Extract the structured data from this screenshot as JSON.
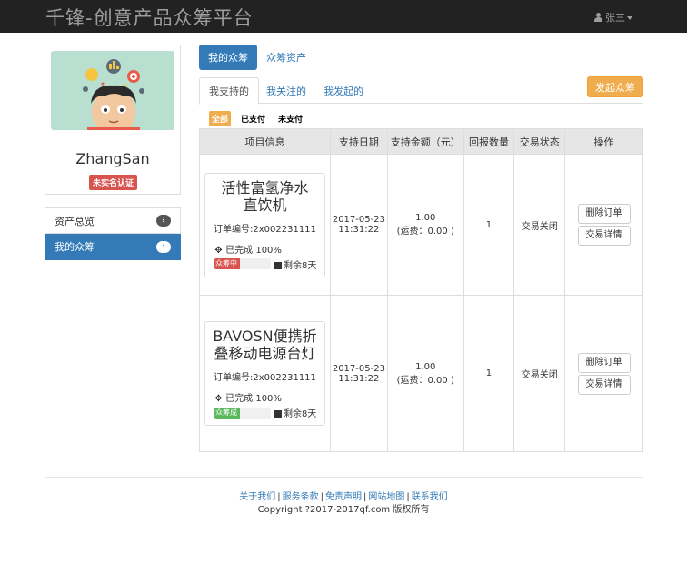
{
  "navbar": {
    "brand": "千锋-创意产品众筹平台",
    "user": "张三"
  },
  "profile": {
    "username": "ZhangSan",
    "badge": "未实名认证"
  },
  "side_menu": [
    {
      "label": "资产总览",
      "active": false
    },
    {
      "label": "我的众筹",
      "active": true
    }
  ],
  "pill_tabs": [
    {
      "label": "我的众筹",
      "active": true
    },
    {
      "label": "众筹资产",
      "active": false
    }
  ],
  "sub_tabs": [
    {
      "label": "我支持的",
      "active": true
    },
    {
      "label": "我关注的",
      "active": false
    },
    {
      "label": "我发起的",
      "active": false
    }
  ],
  "launch_button": "发起众筹",
  "filters": [
    {
      "label": "全部",
      "active": true
    },
    {
      "label": "已支付",
      "active": false
    },
    {
      "label": "未支付",
      "active": false
    }
  ],
  "table": {
    "headers": [
      "项目信息",
      "支持日期",
      "支持金额（元）",
      "回报数量",
      "交易状态",
      "操作"
    ],
    "rows": [
      {
        "title": "活性富氢净水直饮机",
        "order_no": "订单编号:2x002231111",
        "done": "已完成 100%",
        "status_label": "众筹中",
        "status_color": "#d9534f",
        "progress": 100,
        "remain": "剩余8天",
        "date": "2017-05-23",
        "time": "11:31:22",
        "amount": "1.00",
        "shipping": "(运费：0.00 )",
        "qty": "1",
        "trade_status": "交易关闭",
        "btn_delete": "删除订单",
        "btn_detail": "交易详情"
      },
      {
        "title": "BAVOSN便携折叠移动电源台灯",
        "order_no": "订单编号:2x002231111",
        "done": "已完成 100%",
        "status_label": "众筹成",
        "status_color": "#5cb85c",
        "progress": 100,
        "remain": "剩余8天",
        "date": "2017-05-23",
        "time": "11:31:22",
        "amount": "1.00",
        "shipping": "(运费：0.00 )",
        "qty": "1",
        "trade_status": "交易关闭",
        "btn_delete": "删除订单",
        "btn_detail": "交易详情"
      }
    ]
  },
  "footer": {
    "links": [
      "关于我们",
      "服务条款",
      "免责声明",
      "网站地图",
      "联系我们"
    ],
    "copyright": "Copyright ?2017-2017qf.com 版权所有"
  },
  "colors": {
    "primary": "#337ab7",
    "warning": "#f0ad4e",
    "danger": "#d9534f",
    "success": "#5cb85c",
    "navbar": "#222222"
  }
}
